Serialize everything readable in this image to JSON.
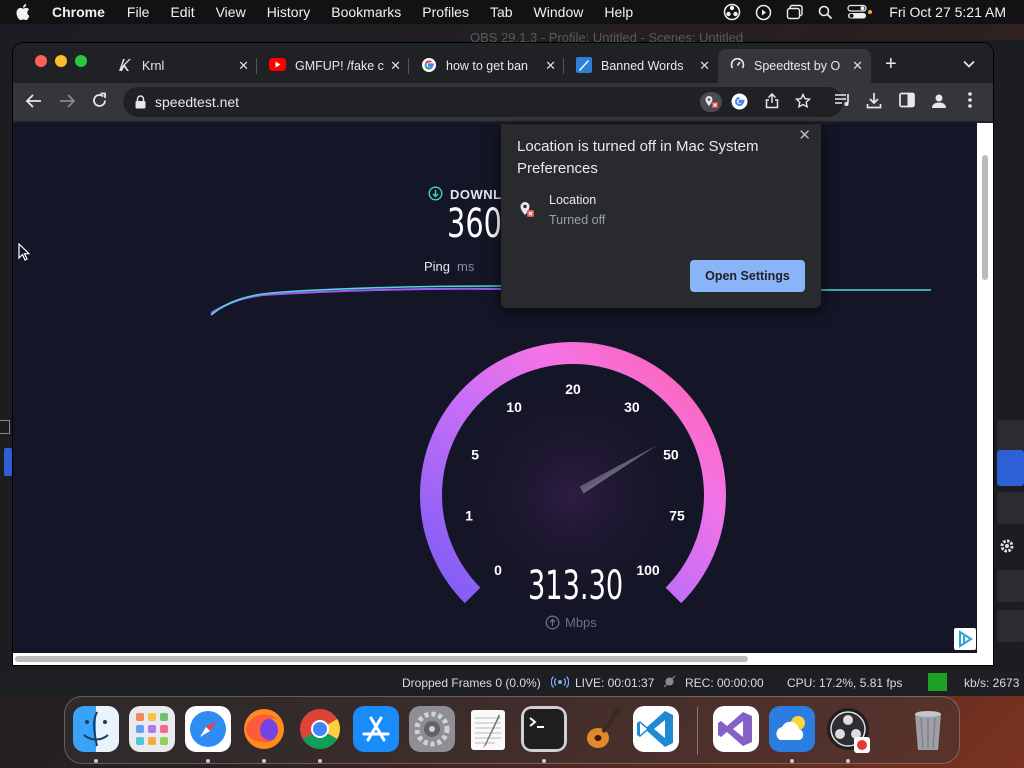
{
  "menubar": {
    "app_name": "Chrome",
    "menus": [
      "File",
      "Edit",
      "View",
      "History",
      "Bookmarks",
      "Profiles",
      "Tab",
      "Window",
      "Help"
    ],
    "clock": "Fri Oct 27  5:21 AM"
  },
  "obs_title": "OBS 29.1.3 - Profile: Untitled - Scenes: Untitled",
  "tabs": [
    {
      "label": "Krnl",
      "icon": "krnl-icon"
    },
    {
      "label": "GMFUP! /fake c",
      "icon": "youtube-icon"
    },
    {
      "label": "how to get ban",
      "icon": "google-icon"
    },
    {
      "label": "Banned Words",
      "icon": "quill-icon"
    },
    {
      "label": "Speedtest by O",
      "icon": "speedtest-icon"
    }
  ],
  "address_bar": {
    "url": "speedtest.net"
  },
  "speedtest": {
    "download_label": "DOWNL",
    "download_value": "360",
    "ping_label": "Ping",
    "ping_unit": "ms",
    "gauge_ticks": [
      "0",
      "1",
      "5",
      "10",
      "20",
      "30",
      "50",
      "75",
      "100"
    ],
    "current_speed": "313.30",
    "speed_unit": "Mbps",
    "needle_level": 0.72
  },
  "location_popup": {
    "title": "Location is turned off in Mac System Preferences",
    "item_label": "Location",
    "item_status": "Turned off",
    "button_label": "Open Settings"
  },
  "obs_status": {
    "dropped_frames": "Dropped Frames 0 (0.0%)",
    "live": "LIVE: 00:01:37",
    "rec": "REC: 00:00:00",
    "cpu": "CPU: 17.2%, 5.81 fps",
    "kbs": "kb/s: 2673"
  },
  "colors": {
    "gauge_start": "#7a5cf5",
    "gauge_end": "#ff5fa8",
    "popup_button": "#8ab4f8",
    "page_bg": "#141526"
  },
  "dock_apps": [
    "finder-icon",
    "launchpad-icon",
    "safari-icon",
    "firefox-icon",
    "chrome-icon",
    "app-store-icon",
    "system-settings-icon",
    "textedit-icon",
    "terminal-icon",
    "garageband-icon",
    "vscode-icon",
    "visual-studio-icon",
    "weather-icon",
    "obs-icon",
    "trash-icon"
  ]
}
